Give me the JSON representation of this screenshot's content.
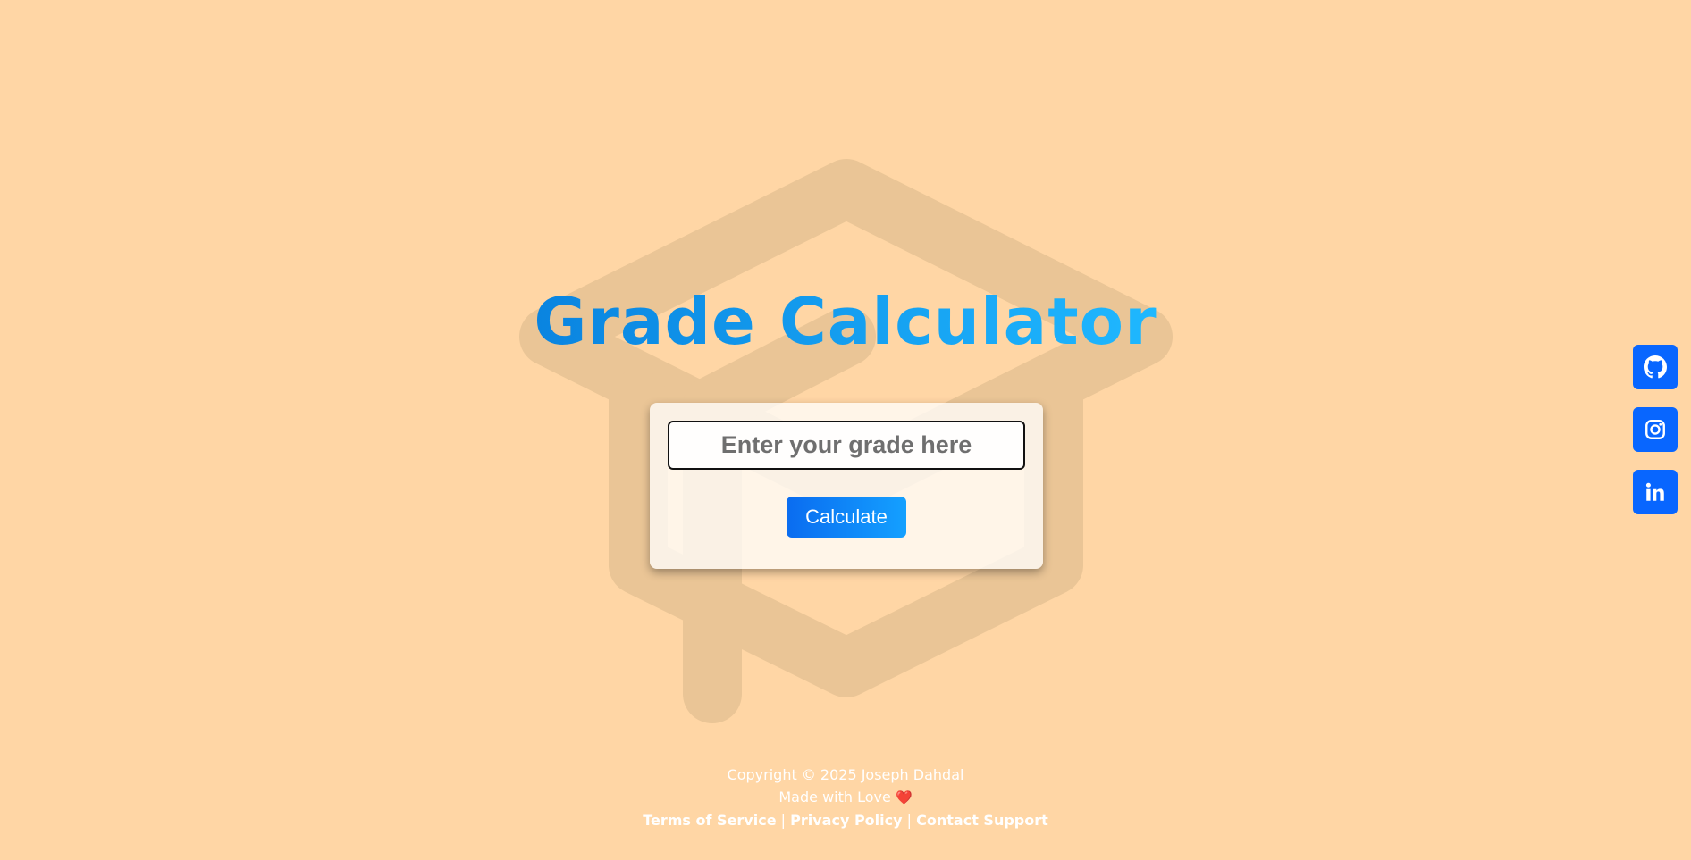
{
  "title": "Grade Calculator",
  "form": {
    "input_placeholder": "Enter your grade here",
    "input_value": "",
    "button_label": "Calculate"
  },
  "social": [
    {
      "name": "github-icon"
    },
    {
      "name": "instagram-icon"
    },
    {
      "name": "linkedin-icon"
    }
  ],
  "footer": {
    "copyright": "Copyright © 2025 Joseph Dahdal",
    "made_with": "Made with Love",
    "heart": "❤️",
    "links": {
      "terms": "Terms of Service",
      "privacy": "Privacy Policy",
      "contact": "Contact Support",
      "separator": "|"
    }
  },
  "colors": {
    "background": "#FFD6A5",
    "accent": "#0866FF",
    "title_gradient_start": "#0A84E0",
    "title_gradient_end": "#1FB8FF",
    "watermark": "#EAC596"
  }
}
